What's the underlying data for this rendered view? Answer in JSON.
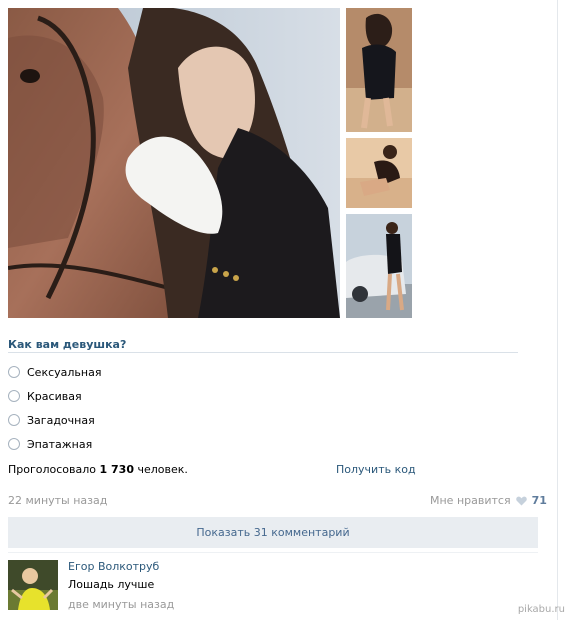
{
  "photos": [
    {
      "name": "main-photo",
      "alt": "woman-with-horse"
    },
    {
      "name": "thumb-1",
      "alt": "woman-portrait-1"
    },
    {
      "name": "thumb-2",
      "alt": "woman-portrait-2"
    },
    {
      "name": "thumb-3",
      "alt": "woman-with-car"
    }
  ],
  "poll": {
    "question": "Как вам девушка?",
    "options": [
      "Сексуальная",
      "Красивая",
      "Загадочная",
      "Эпатажная"
    ],
    "voted_prefix": "Проголосовало",
    "voted_count": "1 730",
    "voted_suffix": "человек.",
    "get_code": "Получить код"
  },
  "post": {
    "time": "22 минуты назад",
    "like_label": "Мне нравится",
    "like_count": "71",
    "show_comments": "Показать 31 комментарий"
  },
  "comment": {
    "author": "Егор Волкотруб",
    "text": "Лошадь лучше",
    "time": "две минуты назад"
  },
  "watermark": "pikabu.ru",
  "colors": {
    "link": "#2b587a",
    "muted": "#999999",
    "button_bg": "#e9edf1",
    "like": "#5f7c9c"
  }
}
